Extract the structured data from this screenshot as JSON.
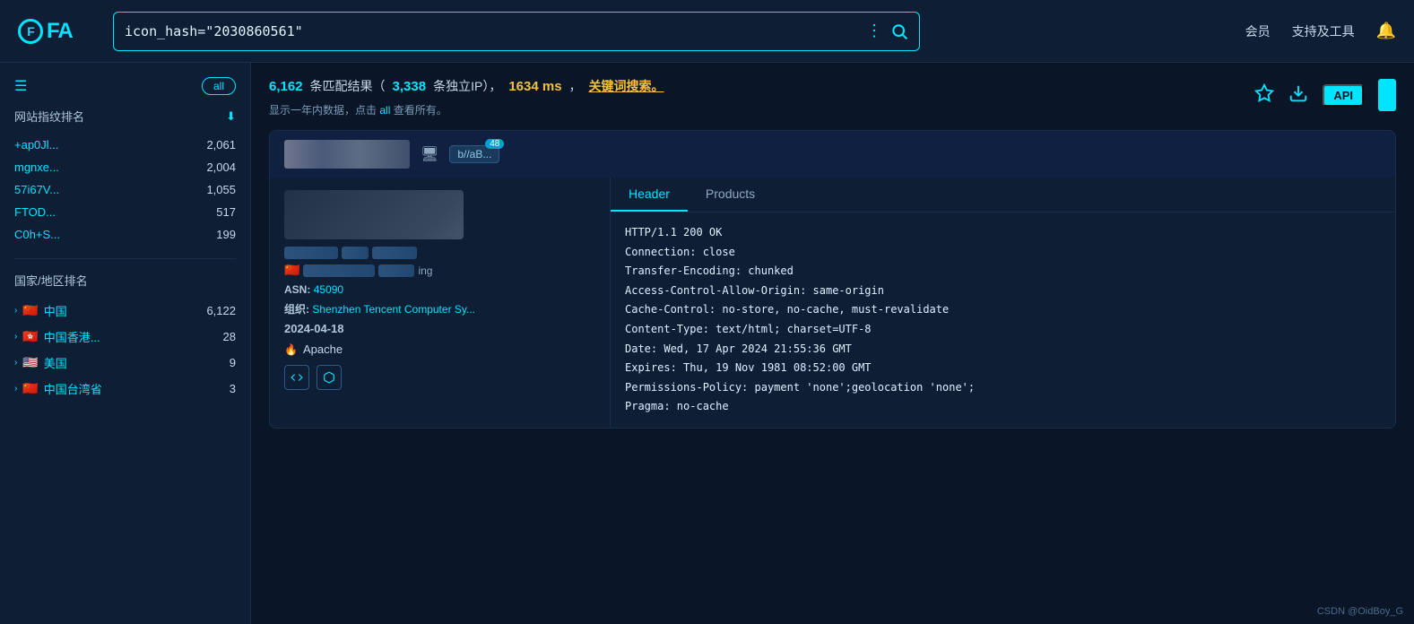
{
  "header": {
    "logo_text": "FOFA",
    "search_query": "icon_hash=\"2030860561\"",
    "nav": {
      "member": "会员",
      "support_tools": "支持及工具"
    }
  },
  "sidebar": {
    "filter_label": "all",
    "fingerprint_section": "网站指纹排名",
    "fingerprint_items": [
      {
        "label": "+ap0Jl...",
        "count": "2,061"
      },
      {
        "label": "mgnxe...",
        "count": "2,004"
      },
      {
        "label": "57i67V...",
        "count": "1,055"
      },
      {
        "label": "FTOD...",
        "count": "517"
      },
      {
        "label": "C0h+S...",
        "count": "199"
      }
    ],
    "country_section": "国家/地区排名",
    "country_items": [
      {
        "label": "中国",
        "flag": "🇨🇳",
        "count": "6,122"
      },
      {
        "label": "中国香港...",
        "flag": "🇭🇰",
        "count": "28"
      },
      {
        "label": "美国",
        "flag": "🇺🇸",
        "count": "9"
      },
      {
        "label": "中国台湾省",
        "flag": "🇨🇳",
        "count": "3"
      }
    ]
  },
  "results": {
    "count": "6,162",
    "count_label": " 条匹配结果（",
    "ip_count": "3,338",
    "ip_label": " 条独立IP），",
    "ms": "1634 ms",
    "ms_label": "，",
    "keyword_label": "关键词搜索。",
    "subtext": "显示一年内数据，点击",
    "all_link": "all",
    "subtext2": "查看所有。"
  },
  "result_card": {
    "tag_text": "b//aB...",
    "tag_badge": "48",
    "asn_label": "ASN:",
    "asn_value": "45090",
    "org_label": "组织:",
    "org_value": "Shenzhen Tencent Computer Sy...",
    "date": "2024-04-18",
    "tech_label": "Apache",
    "tabs": {
      "header": "Header",
      "products": "Products"
    },
    "header_content": [
      "HTTP/1.1 200 OK",
      "Connection: close",
      "Transfer-Encoding: chunked",
      "Access-Control-Allow-Origin: same-origin",
      "Cache-Control: no-store, no-cache, must-revalidate",
      "Content-Type: text/html; charset=UTF-8",
      "Date: Wed, 17 Apr 2024 21:55:36 GMT",
      "Expires: Thu, 19 Nov 1981 08:52:00 GMT",
      "Permissions-Policy: payment 'none';geolocation 'none';",
      "Pragma: no-cache"
    ]
  },
  "actions": {
    "star_icon": "★",
    "download_icon": "↓",
    "api_label": "API"
  },
  "watermark": "CSDN @OidBoy_G"
}
